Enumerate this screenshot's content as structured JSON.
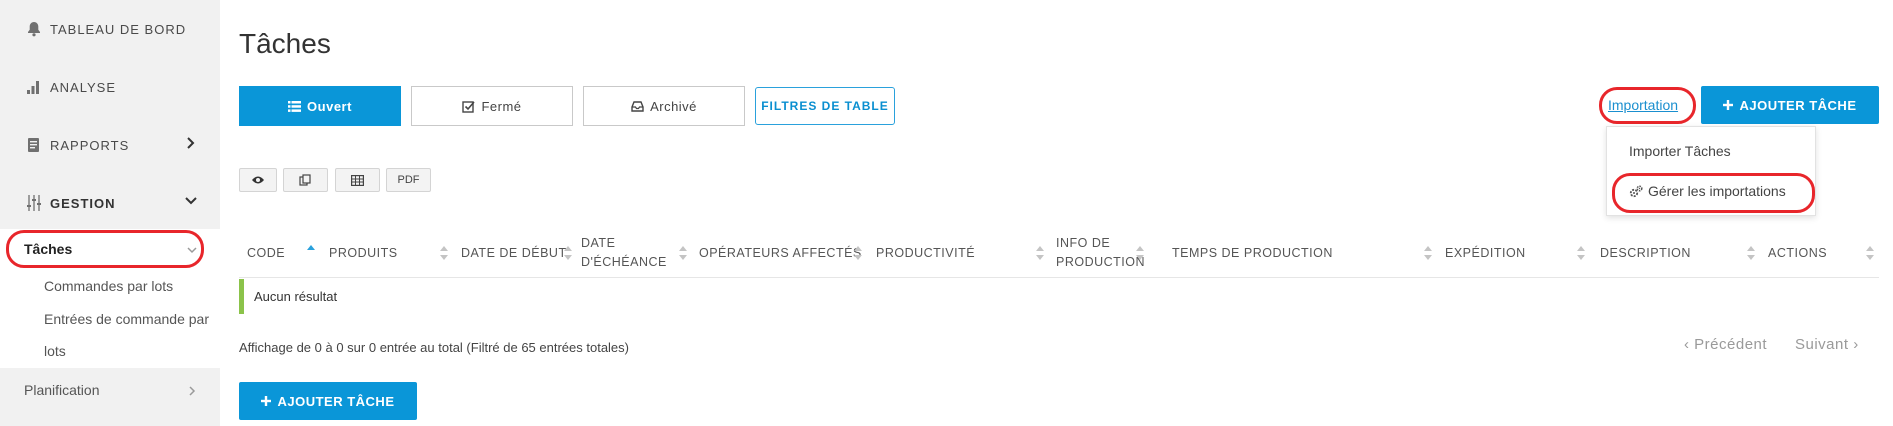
{
  "sidebar": {
    "dashboard": "TABLEAU DE BORD",
    "analyse": "ANALYSE",
    "rapports": "RAPPORTS",
    "gestion": "GESTION",
    "taches": "Tâches",
    "commandes": "Commandes par lots",
    "entrees_line1": "Entrées de commande par",
    "entrees_line2": "lots",
    "planification": "Planification"
  },
  "header": {
    "title": "Tâches"
  },
  "toolbar": {
    "tab_ouvert": "Ouvert",
    "tab_ferme": "Fermé",
    "tab_archive": "Archivé",
    "filtres": "FILTRES DE TABLE",
    "importation": "Importation",
    "ajouter": "AJOUTER TÂCHE"
  },
  "import_menu": {
    "importer": "Importer Tâches",
    "gerer": "Gérer les importations"
  },
  "export_buttons": {
    "pdf": "PDF"
  },
  "table": {
    "headers": [
      "CODE",
      "PRODUITS",
      "DATE DE DÉBUT",
      "DATE D'ÉCHÉANCE",
      "OPÉRATEURS AFFECTÉS",
      "PRODUCTIVITÉ",
      "INFO DE PRODUCTION",
      "TEMPS DE PRODUCTION",
      "EXPÉDITION",
      "DESCRIPTION",
      "ACTIONS"
    ],
    "empty": "Aucun résultat",
    "info": "Affichage de 0 à 0 sur 0 entrée au total (Filtré de 65 entrées totales)"
  },
  "pagination": {
    "prev": "‹ Précédent",
    "next": "Suivant ›"
  },
  "footer": {
    "ajouter": "AJOUTER TÂCHE"
  },
  "colors": {
    "primary": "#0a96d8",
    "highlight": "#e8262b",
    "empty_marker": "#8bc34a",
    "sidebar_bg": "#f1f1f1"
  }
}
